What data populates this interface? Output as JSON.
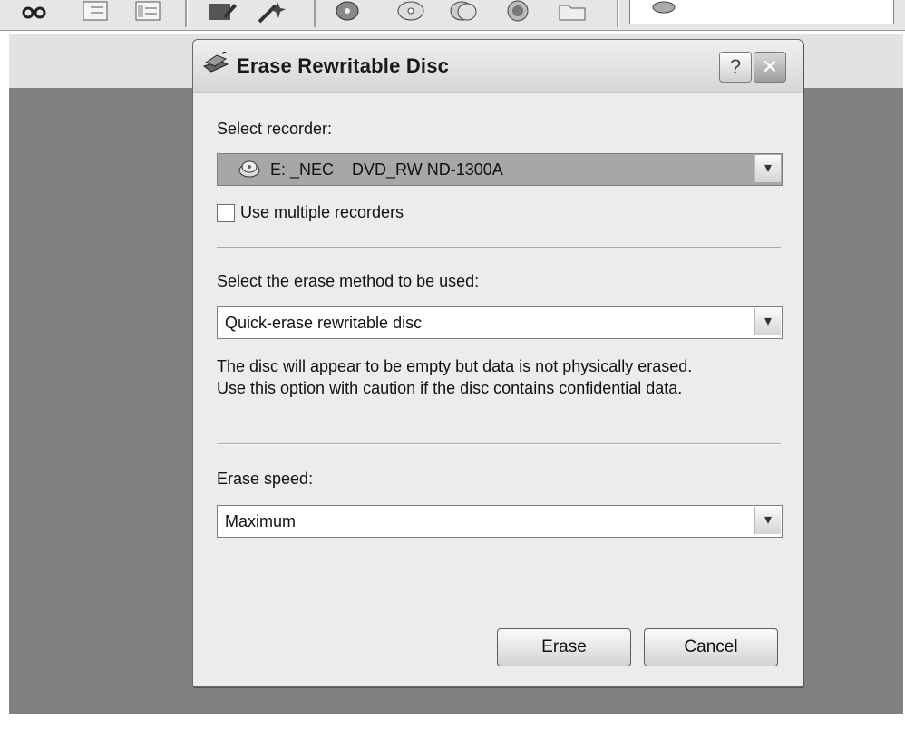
{
  "toolbar": {
    "icons": [
      "scissors-icon",
      "list-icon",
      "list-view-icon",
      "edit-icon",
      "wizard-icon",
      "disc-icon",
      "cd-icon",
      "disc-copy-icon",
      "record-icon",
      "folder-icon",
      "image-recorder-icon"
    ]
  },
  "dialog": {
    "title": "Erase Rewritable Disc",
    "help_label": "?",
    "close_label": "✕",
    "recorder": {
      "label": "Select recorder:",
      "value": "E: _NEC    DVD_RW ND-1300A"
    },
    "multiple_recorders_label": "Use multiple recorders",
    "erase_method": {
      "label": "Select the erase method to be used:",
      "value": "Quick-erase rewritable disc",
      "description_line1": "The disc will appear to be empty but data is not physically erased.",
      "description_line2": "Use this option with caution if the disc contains confidential data."
    },
    "erase_speed": {
      "label": "Erase speed:",
      "value": "Maximum"
    },
    "erase_button": "Erase",
    "cancel_button": "Cancel"
  },
  "colors": {
    "workspace": "#818181",
    "dialog_bg": "#ececec",
    "selection": "#a7a7a7"
  }
}
